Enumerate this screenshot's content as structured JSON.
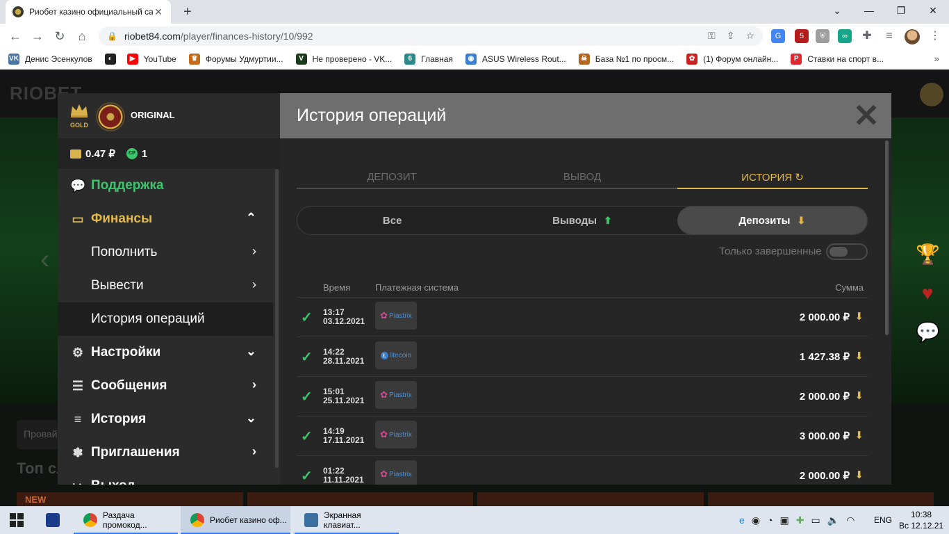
{
  "browser": {
    "tab_title": "Риобет казино официальный са",
    "url_host": "riobet84.com",
    "url_path": "/player/finances-history/10/992",
    "ext_badge": "5",
    "bookmarks": [
      {
        "label": "Денис Эсенкулов",
        "color": "#4a76a8",
        "glyph": "VK"
      },
      {
        "label": "",
        "color": "#222222",
        "glyph": "◐"
      },
      {
        "label": "YouTube",
        "color": "#ff0000",
        "glyph": "▶"
      },
      {
        "label": "Форумы Удмуртии...",
        "color": "#c46a1a",
        "glyph": "♛"
      },
      {
        "label": "Не проверено - VK...",
        "color": "#1a3a1a",
        "glyph": "V"
      },
      {
        "label": "Главная",
        "color": "#2a8a8a",
        "glyph": "6"
      },
      {
        "label": "ASUS Wireless Rout...",
        "color": "#3a7fd0",
        "glyph": "◉"
      },
      {
        "label": "База №1 по просм...",
        "color": "#b5651d",
        "glyph": "☠"
      },
      {
        "label": "(1) Форум онлайн...",
        "color": "#cc2222",
        "glyph": "✿"
      },
      {
        "label": "Ставки на спорт в...",
        "color": "#e0282e",
        "glyph": "P"
      }
    ]
  },
  "site": {
    "logo": "RIOBET",
    "search_placeholder": "Провай",
    "section_title": "Топ сл",
    "new_badge": "NEW"
  },
  "sidebar": {
    "tier": "GOLD",
    "rank": "ORIGINAL",
    "balance": "0.47 ₽",
    "cp": "1",
    "cp_label": "CP",
    "items": [
      {
        "label": "Поддержка",
        "icon": "chat-bubble-icon",
        "style": "green",
        "chevron": ""
      },
      {
        "label": "Финансы",
        "icon": "wallet-icon",
        "style": "gold",
        "chevron": "⌃"
      },
      {
        "label": "Пополнить",
        "icon": "",
        "style": "sub",
        "chevron": "›"
      },
      {
        "label": "Вывести",
        "icon": "",
        "style": "sub",
        "chevron": "›"
      },
      {
        "label": "История операций",
        "icon": "",
        "style": "sub active",
        "chevron": ""
      },
      {
        "label": "Настройки",
        "icon": "gear-icon",
        "style": "",
        "chevron": "⌄"
      },
      {
        "label": "Сообщения",
        "icon": "message-icon",
        "style": "",
        "chevron": "›"
      },
      {
        "label": "История",
        "icon": "list-icon",
        "style": "",
        "chevron": "⌄"
      },
      {
        "label": "Приглашения",
        "icon": "invite-icon",
        "style": "",
        "chevron": "›"
      },
      {
        "label": "Выход",
        "icon": "logout-icon",
        "style": "",
        "chevron": ""
      }
    ]
  },
  "modal": {
    "title": "История операций",
    "tabs": [
      "ДЕПОЗИТ",
      "ВЫВОД",
      "ИСТОРИЯ"
    ],
    "active_tab": 2,
    "filters": [
      {
        "label": "Все",
        "arrow": ""
      },
      {
        "label": "Выводы",
        "arrow": "⬆"
      },
      {
        "label": "Депозиты",
        "arrow": "⬇"
      }
    ],
    "active_filter": 2,
    "only_completed_label": "Только завершенные",
    "only_completed": false,
    "columns": {
      "time": "Время",
      "system": "Платежная система",
      "sum": "Сумма"
    },
    "rows": [
      {
        "time": "13:17",
        "date": "03.12.2021",
        "system": "Piastrix",
        "amount": "2 000.00 ₽"
      },
      {
        "time": "14:22",
        "date": "28.11.2021",
        "system": "litecoin",
        "amount": "1 427.38 ₽"
      },
      {
        "time": "15:01",
        "date": "25.11.2021",
        "system": "Piastrix",
        "amount": "2 000.00 ₽"
      },
      {
        "time": "14:19",
        "date": "17.11.2021",
        "system": "Piastrix",
        "amount": "3 000.00 ₽"
      },
      {
        "time": "01:22",
        "date": "11.11.2021",
        "system": "Piastrix",
        "amount": "2 000.00 ₽"
      }
    ]
  },
  "taskbar": {
    "items": [
      {
        "label": "Раздача промокод...",
        "active": false
      },
      {
        "label": "Риобет казино оф...",
        "active": true
      },
      {
        "label": "Экранная клавиат...",
        "active": false
      }
    ],
    "lang": "ENG",
    "time": "10:38",
    "date": "Вс 12.12.21"
  }
}
